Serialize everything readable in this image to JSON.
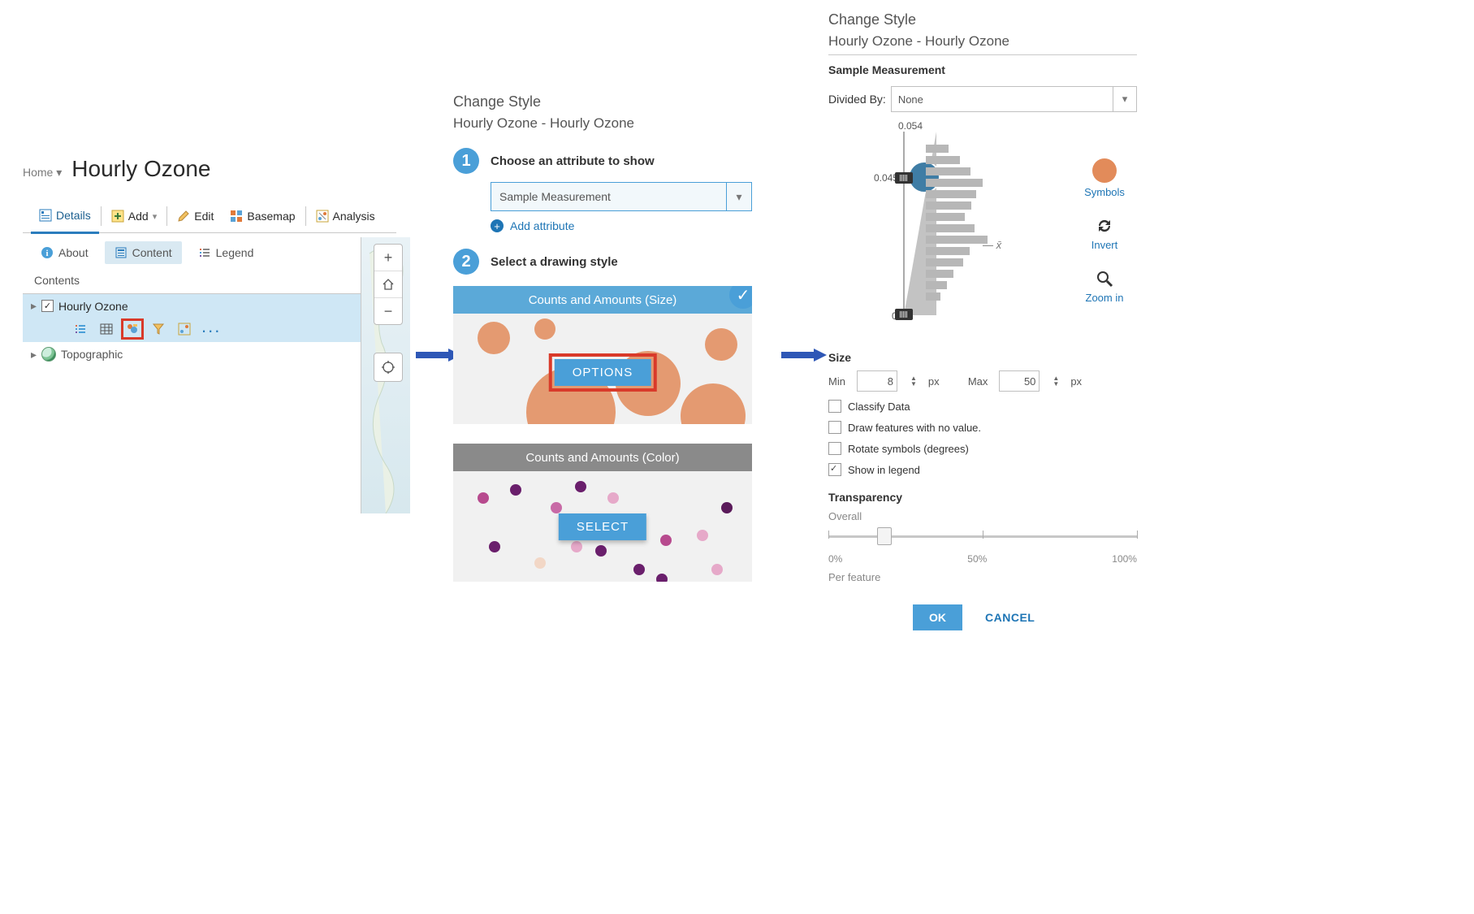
{
  "left": {
    "home_label": "Home",
    "map_title": "Hourly Ozone",
    "toolbar": {
      "details": "Details",
      "add": "Add",
      "edit": "Edit",
      "basemap": "Basemap",
      "analysis": "Analysis"
    },
    "subnav": {
      "about": "About",
      "content": "Content",
      "legend": "Legend"
    },
    "contents_label": "Contents",
    "layer": {
      "name": "Hourly Ozone",
      "checked": true,
      "more_dots": "..."
    },
    "basemap_layer": "Topographic"
  },
  "mid": {
    "title": "Change Style",
    "subtitle": "Hourly Ozone - Hourly Ozone",
    "step1_label": "Choose an attribute to show",
    "step1_num": "1",
    "attribute_selected": "Sample Measurement",
    "add_attribute": "Add attribute",
    "step2_label": "Select a drawing style",
    "step2_num": "2",
    "style1": {
      "header": "Counts and Amounts (Size)",
      "button": "OPTIONS"
    },
    "style2": {
      "header": "Counts and Amounts (Color)",
      "button": "SELECT"
    }
  },
  "right": {
    "title": "Change Style",
    "subtitle": "Hourly Ozone - Hourly Ozone",
    "attribute": "Sample Measurement",
    "divided_by_label": "Divided By:",
    "divided_by_value": "None",
    "ramp": {
      "top": "0.054",
      "break": "0.045",
      "bottom": "0",
      "mean_symbol": "x̄"
    },
    "side_tools": {
      "symbols": "Symbols",
      "invert": "Invert",
      "zoom": "Zoom in"
    },
    "size": {
      "header": "Size",
      "min_label": "Min",
      "min_value": "8",
      "px": "px",
      "max_label": "Max",
      "max_value": "50"
    },
    "checks": {
      "classify": "Classify Data",
      "no_value": "Draw features with no value.",
      "rotate": "Rotate symbols (degrees)",
      "legend": "Show in legend"
    },
    "transparency": {
      "header": "Transparency",
      "overall": "Overall",
      "per_feature": "Per feature",
      "ticks": {
        "t0": "0%",
        "t50": "50%",
        "t100": "100%"
      },
      "value_pct": 18
    },
    "buttons": {
      "ok": "OK",
      "cancel": "CANCEL"
    }
  }
}
